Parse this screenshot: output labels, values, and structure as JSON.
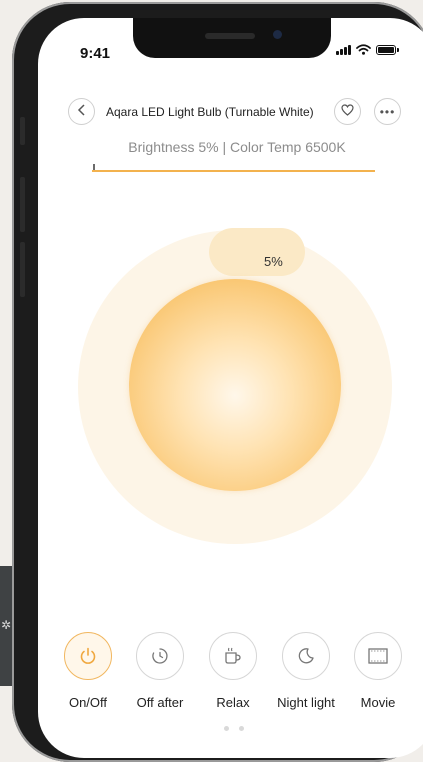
{
  "status_bar": {
    "time": "9:41"
  },
  "header": {
    "title": "Aqara LED Light Bulb (Turnable White)",
    "back_icon": "chevron-left-icon",
    "favorite_icon": "heart-icon",
    "more_icon": "ellipsis-icon"
  },
  "status_text": "Brightness 5% | Color Temp 6500K",
  "brightness": {
    "value_percent": 5,
    "label": "5%"
  },
  "colors": {
    "accent": "#f3b24e",
    "disk_edge": "#f2ae46",
    "halo": "#fdf5e7",
    "bubble": "#fbe9c6"
  },
  "modes": [
    {
      "label": "On/Off",
      "icon": "power-icon",
      "active": true
    },
    {
      "label": "Off after",
      "icon": "timer-icon",
      "active": false
    },
    {
      "label": "Relax",
      "icon": "cup-icon",
      "active": false
    },
    {
      "label": "Night light",
      "icon": "moon-icon",
      "active": false
    },
    {
      "label": "Movie",
      "icon": "film-icon",
      "active": false
    }
  ],
  "pager": {
    "pages": 2,
    "current": 1
  }
}
